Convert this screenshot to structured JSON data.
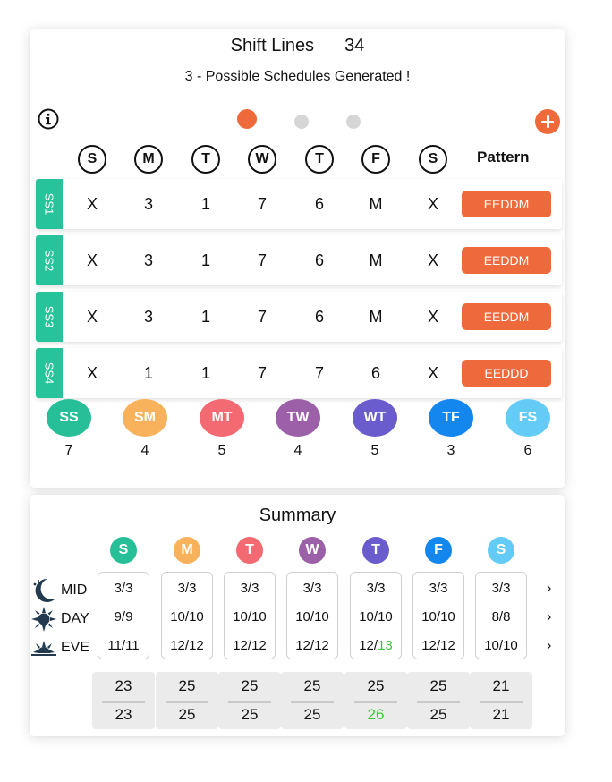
{
  "header": {
    "title": "Shift Lines",
    "count": "34",
    "subtitle": "3 - Possible Schedules Generated !"
  },
  "days": [
    "S",
    "M",
    "T",
    "W",
    "T",
    "F",
    "S"
  ],
  "pattern_header": "Pattern",
  "schedules": [
    {
      "id": "SS1",
      "values": [
        "X",
        "3",
        "1",
        "7",
        "6",
        "M",
        "X"
      ],
      "pattern": "EEDDM"
    },
    {
      "id": "SS2",
      "values": [
        "X",
        "3",
        "1",
        "7",
        "6",
        "M",
        "X"
      ],
      "pattern": "EEDDM"
    },
    {
      "id": "SS3",
      "values": [
        "X",
        "3",
        "1",
        "7",
        "6",
        "M",
        "X"
      ],
      "pattern": "EEDDM"
    },
    {
      "id": "SS4",
      "values": [
        "X",
        "1",
        "1",
        "7",
        "7",
        "6",
        "X"
      ],
      "pattern": "EEDDD"
    }
  ],
  "stats": [
    {
      "label": "SS",
      "count": "7",
      "color": "#26bf98"
    },
    {
      "label": "SM",
      "count": "4",
      "color": "#f8b25b"
    },
    {
      "label": "MT",
      "count": "5",
      "color": "#f36a72"
    },
    {
      "label": "TW",
      "count": "4",
      "color": "#9c60a8"
    },
    {
      "label": "WT",
      "count": "5",
      "color": "#6a5ccc"
    },
    {
      "label": "TF",
      "count": "3",
      "color": "#1487ee"
    },
    {
      "label": "FS",
      "count": "6",
      "color": "#63cbf6"
    }
  ],
  "summary": {
    "title": "Summary",
    "day_circles": [
      {
        "label": "S",
        "color": "#26bf98"
      },
      {
        "label": "M",
        "color": "#f8b25b"
      },
      {
        "label": "T",
        "color": "#f36a72"
      },
      {
        "label": "W",
        "color": "#9c60a8"
      },
      {
        "label": "T",
        "color": "#6a5ccc"
      },
      {
        "label": "F",
        "color": "#1487ee"
      },
      {
        "label": "S",
        "color": "#63cbf6"
      }
    ],
    "shift_labels": [
      "MID",
      "DAY",
      "EVE"
    ],
    "columns": [
      {
        "mid": "3/3",
        "day": "9/9",
        "eve_a": "11/11",
        "eve_b": "",
        "total_top": "23",
        "total_bottom": "23"
      },
      {
        "mid": "3/3",
        "day": "10/10",
        "eve_a": "12/12",
        "eve_b": "",
        "total_top": "25",
        "total_bottom": "25"
      },
      {
        "mid": "3/3",
        "day": "10/10",
        "eve_a": "12/12",
        "eve_b": "",
        "total_top": "25",
        "total_bottom": "25"
      },
      {
        "mid": "3/3",
        "day": "10/10",
        "eve_a": "12/12",
        "eve_b": "",
        "total_top": "25",
        "total_bottom": "25"
      },
      {
        "mid": "3/3",
        "day": "10/10",
        "eve_a": "12/",
        "eve_b": "13",
        "total_top": "25",
        "total_bottom": "26"
      },
      {
        "mid": "3/3",
        "day": "10/10",
        "eve_a": "12/12",
        "eve_b": "",
        "total_top": "25",
        "total_bottom": "25"
      },
      {
        "mid": "3/3",
        "day": "8/8",
        "eve_a": "10/10",
        "eve_b": "",
        "total_top": "21",
        "total_bottom": "21"
      }
    ],
    "arrow_glyph": "›",
    "highlight_color": "#3cc637"
  },
  "icons": {
    "info": "info-icon",
    "add": "plus-icon",
    "mid": "moon-icon",
    "day": "sun-icon",
    "eve": "sunset-icon"
  }
}
